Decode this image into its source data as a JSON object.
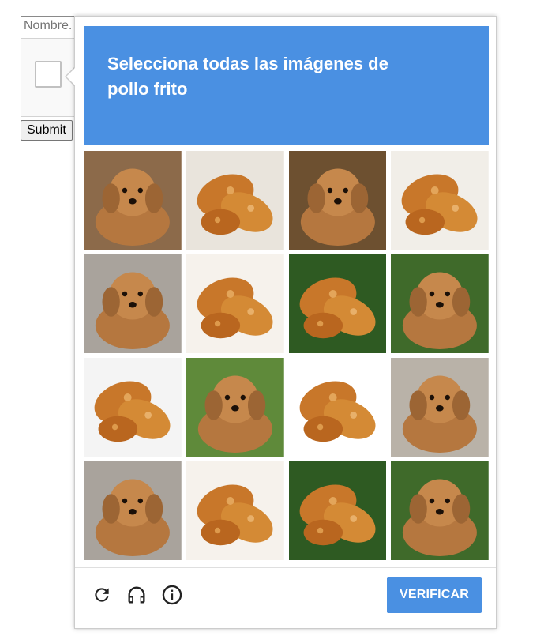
{
  "form": {
    "name_placeholder": "Nombre.",
    "submit_label": "Submit"
  },
  "challenge": {
    "instruction": "Selecciona todas las imágenes de\npollo frito",
    "accent_color": "#4a90e2",
    "tiles": [
      {
        "subject": "dog"
      },
      {
        "subject": "fried-chicken"
      },
      {
        "subject": "dog"
      },
      {
        "subject": "fried-chicken"
      },
      {
        "subject": "dog"
      },
      {
        "subject": "fried-chicken"
      },
      {
        "subject": "fried-chicken"
      },
      {
        "subject": "dog"
      },
      {
        "subject": "fried-chicken"
      },
      {
        "subject": "dog"
      },
      {
        "subject": "fried-chicken"
      },
      {
        "subject": "dog"
      },
      {
        "subject": "dog"
      },
      {
        "subject": "fried-chicken"
      },
      {
        "subject": "fried-chicken"
      },
      {
        "subject": "dog"
      }
    ],
    "footer": {
      "icons": [
        "reload-icon",
        "headphones-icon",
        "info-icon"
      ],
      "verify_label": "VERIFICAR"
    }
  }
}
